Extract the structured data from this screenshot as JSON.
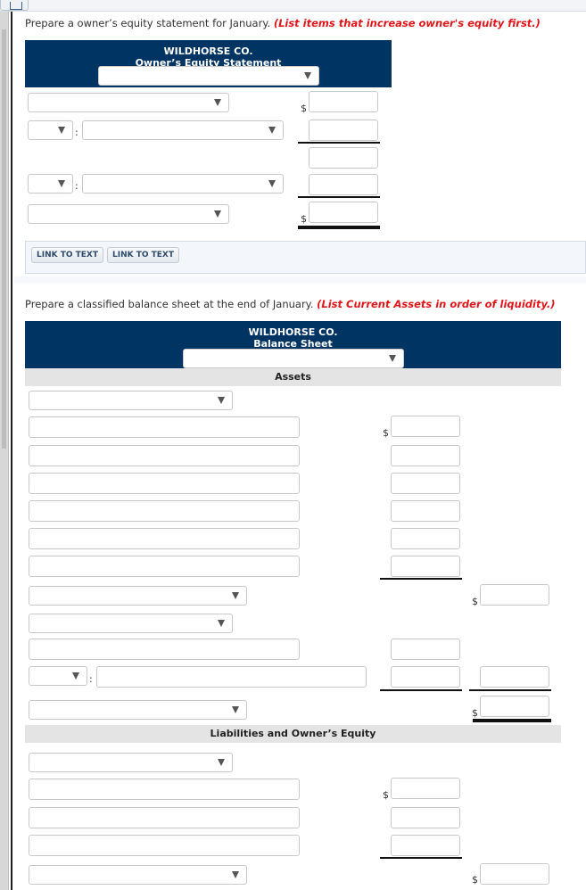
{
  "equity_section": {
    "prompt": "Prepare a owner’s equity statement for January.",
    "hint": "(List items that increase owner's equity first.)",
    "company": "WILDHORSE CO.",
    "statement_title": "Owner’s Equity Statement",
    "date_select": "",
    "currency_symbol": "$",
    "rows": [
      {
        "label_select": "",
        "amount": ""
      },
      {
        "prefix_select": "",
        "label_select": "",
        "amount": ""
      },
      {
        "amount": ""
      },
      {
        "prefix_select": "",
        "label_select": "",
        "amount": ""
      },
      {
        "label_select": "",
        "amount": ""
      }
    ],
    "buttons": [
      "LINK TO TEXT",
      "LINK TO TEXT"
    ]
  },
  "balance_section": {
    "prompt": "Prepare a classified balance sheet at the end of January.",
    "hint": "(List Current Assets in order of liquidity.)",
    "company": "WILDHORSE CO.",
    "statement_title": "Balance Sheet",
    "date_select": "",
    "currency_symbol": "$",
    "assets_band": "Assets",
    "liabilities_band": "Liabilities and Owner’s Equity"
  }
}
